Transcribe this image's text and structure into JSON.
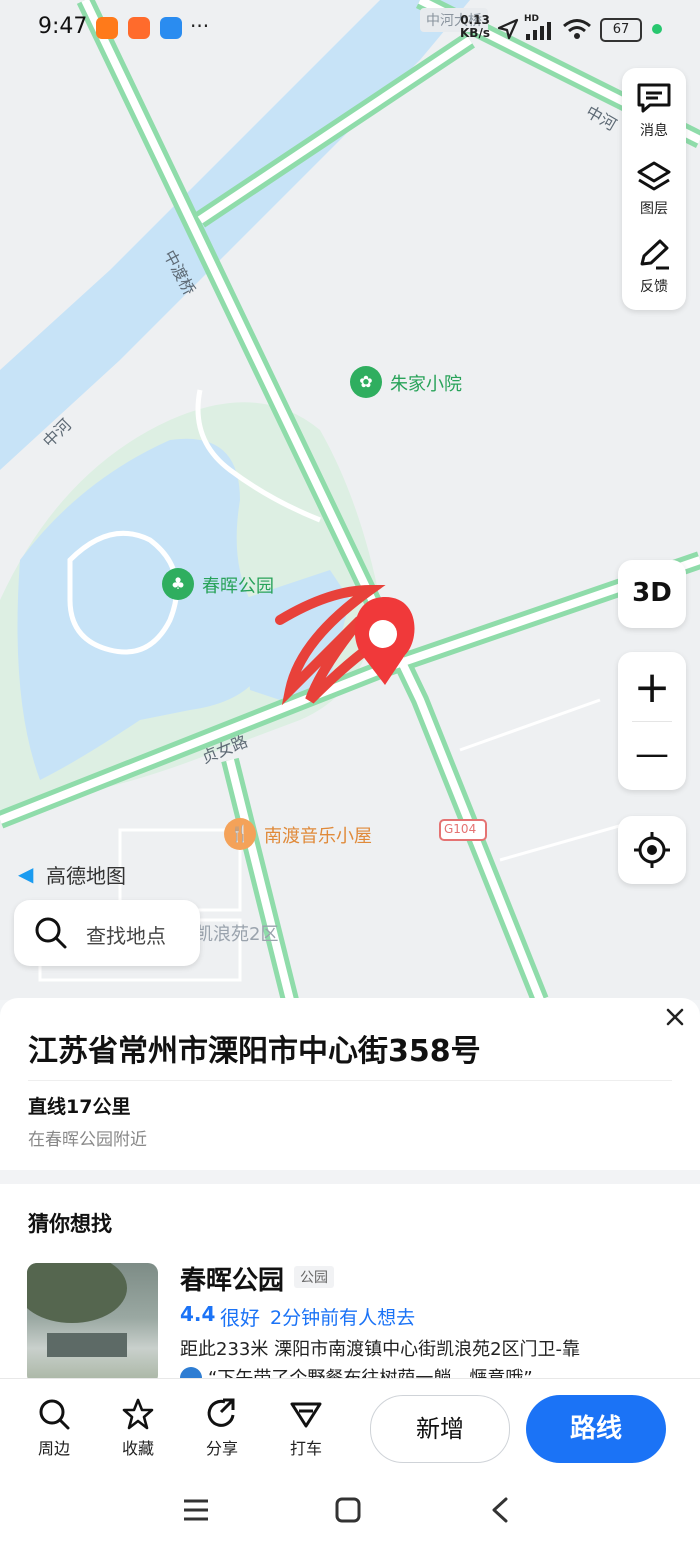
{
  "status_bar": {
    "time": "9:47",
    "net_speed_value": "0.13",
    "net_speed_unit": "KB/s",
    "hd": "HD",
    "battery": "67"
  },
  "map": {
    "provider_logo": "高德地图",
    "pois": {
      "zhujia": "朱家小院",
      "chunhui": "春晖公园",
      "nandu": "南渡音乐小屋",
      "kailang": "凯浪苑2区"
    },
    "roads": {
      "zhongdu_bridge": "中渡桥",
      "zhonghe": "中河",
      "zhonghe_right": "中河",
      "zhonghe_bridge": "中河大桥",
      "zhennu_road": "贞女路",
      "g104": "G104"
    },
    "colors": {
      "water": "#c7e3f7",
      "green": "#ddefe3",
      "road": "#8fdcaa",
      "land": "#eef0f2"
    }
  },
  "right_controls": {
    "messages": "消息",
    "layers": "图层",
    "feedback": "反馈",
    "three_d": "3D",
    "zoom_in": "+",
    "zoom_out": "—"
  },
  "search": {
    "placeholder": "查找地点"
  },
  "place": {
    "address": "江苏省常州市溧阳市中心街358号",
    "distance": "直线17公里",
    "nearby": "在春晖公园附近"
  },
  "suggest": {
    "header": "猜你想找",
    "item": {
      "name": "春晖公园",
      "tag": "公园",
      "rating": "4.4",
      "rating_text": "很好",
      "recent": "2分钟前有人想去",
      "address_line": "距此233米  溧阳市南渡镇中心街凯浪苑2区门卫-靠",
      "review": "“下午带了个野餐布往树荫一躺，惬意哦”"
    }
  },
  "toolbar": {
    "nearby": "周边",
    "favorite": "收藏",
    "share": "分享",
    "taxi": "打车",
    "add": "新增",
    "route": "路线"
  },
  "accent_color": "#1b73f6"
}
